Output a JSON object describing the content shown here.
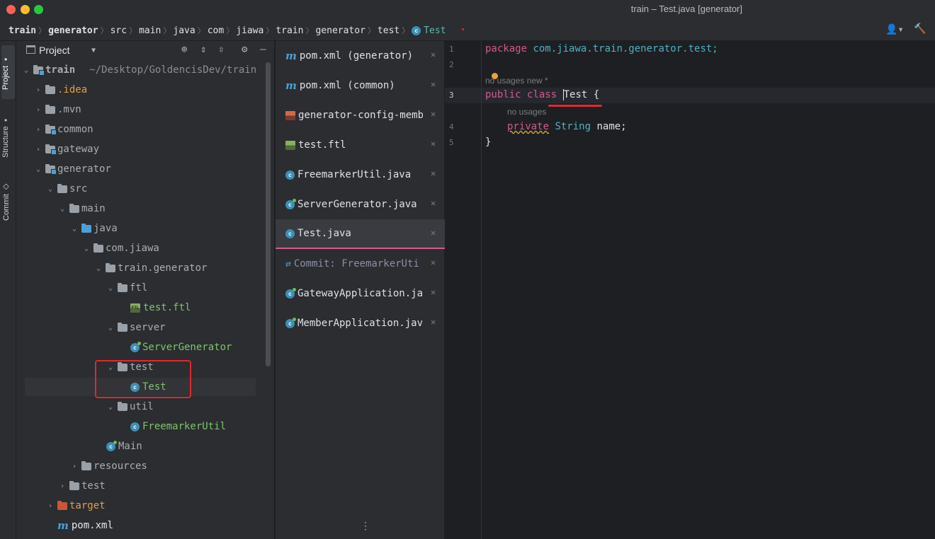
{
  "window": {
    "title": "train – Test.java [generator]"
  },
  "breadcrumb": {
    "items": [
      "train",
      "generator",
      "src",
      "main",
      "java",
      "com",
      "jiawa",
      "train",
      "generator",
      "test"
    ],
    "last": "Test"
  },
  "toolstrip": {
    "project": "Project",
    "structure": "Structure",
    "commit": "Commit"
  },
  "project": {
    "title": "Project",
    "root_name": "train",
    "root_path": "~/Desktop/GoldencisDev/train",
    "nodes": {
      "idea": ".idea",
      "mvn": ".mvn",
      "common": "common",
      "gateway": "gateway",
      "generator": "generator",
      "src": "src",
      "main": "main",
      "java": "java",
      "com_jiawa": "com.jiawa",
      "train_generator": "train.generator",
      "ftl": "ftl",
      "test_ftl": "test.ftl",
      "server": "server",
      "server_generator": "ServerGenerator",
      "test_pkg": "test",
      "test_class": "Test",
      "util": "util",
      "freemarker_util": "FreemarkerUtil",
      "main_class": "Main",
      "resources": "resources",
      "test_dir": "test",
      "target": "target",
      "pom": "pom.xml"
    }
  },
  "recent_files": [
    {
      "label": "pom.xml (generator)",
      "icon": "maven-icon"
    },
    {
      "label": "pom.xml (common)",
      "icon": "maven-icon"
    },
    {
      "label": "generator-config-memb",
      "icon": "xml-config-icon"
    },
    {
      "label": "test.ftl",
      "icon": "ftl-icon"
    },
    {
      "label": "FreemarkerUtil.java",
      "icon": "class-icon"
    },
    {
      "label": "ServerGenerator.java",
      "icon": "class-icon"
    },
    {
      "label": "Test.java",
      "icon": "class-icon"
    },
    {
      "label": "Commit: FreemarkerUti",
      "icon": "commit-icon"
    },
    {
      "label": "GatewayApplication.ja",
      "icon": "class-icon"
    },
    {
      "label": "MemberApplication.jav",
      "icon": "class-icon"
    }
  ],
  "editor": {
    "lines": {
      "l1": "1",
      "l2": "2",
      "l3": "3",
      "l4": "4",
      "l5": "5"
    },
    "code": {
      "package_kw": "package",
      "package_name": " com.jiawa.train.generator.test;",
      "hint1": "no usages  new *",
      "public_kw": "public",
      "class_kw": "class",
      "class_name": "Test",
      "brace_open": "{",
      "hint2": "no usages",
      "private_kw": "private",
      "string_type": "String",
      "field": "name;",
      "brace_close": "}"
    }
  },
  "colors": {
    "accent_pink": "#d15b8f",
    "annotation_red": "#e0282e",
    "folder_blue": "#4f9fd6",
    "text_green": "#7fc46a"
  }
}
